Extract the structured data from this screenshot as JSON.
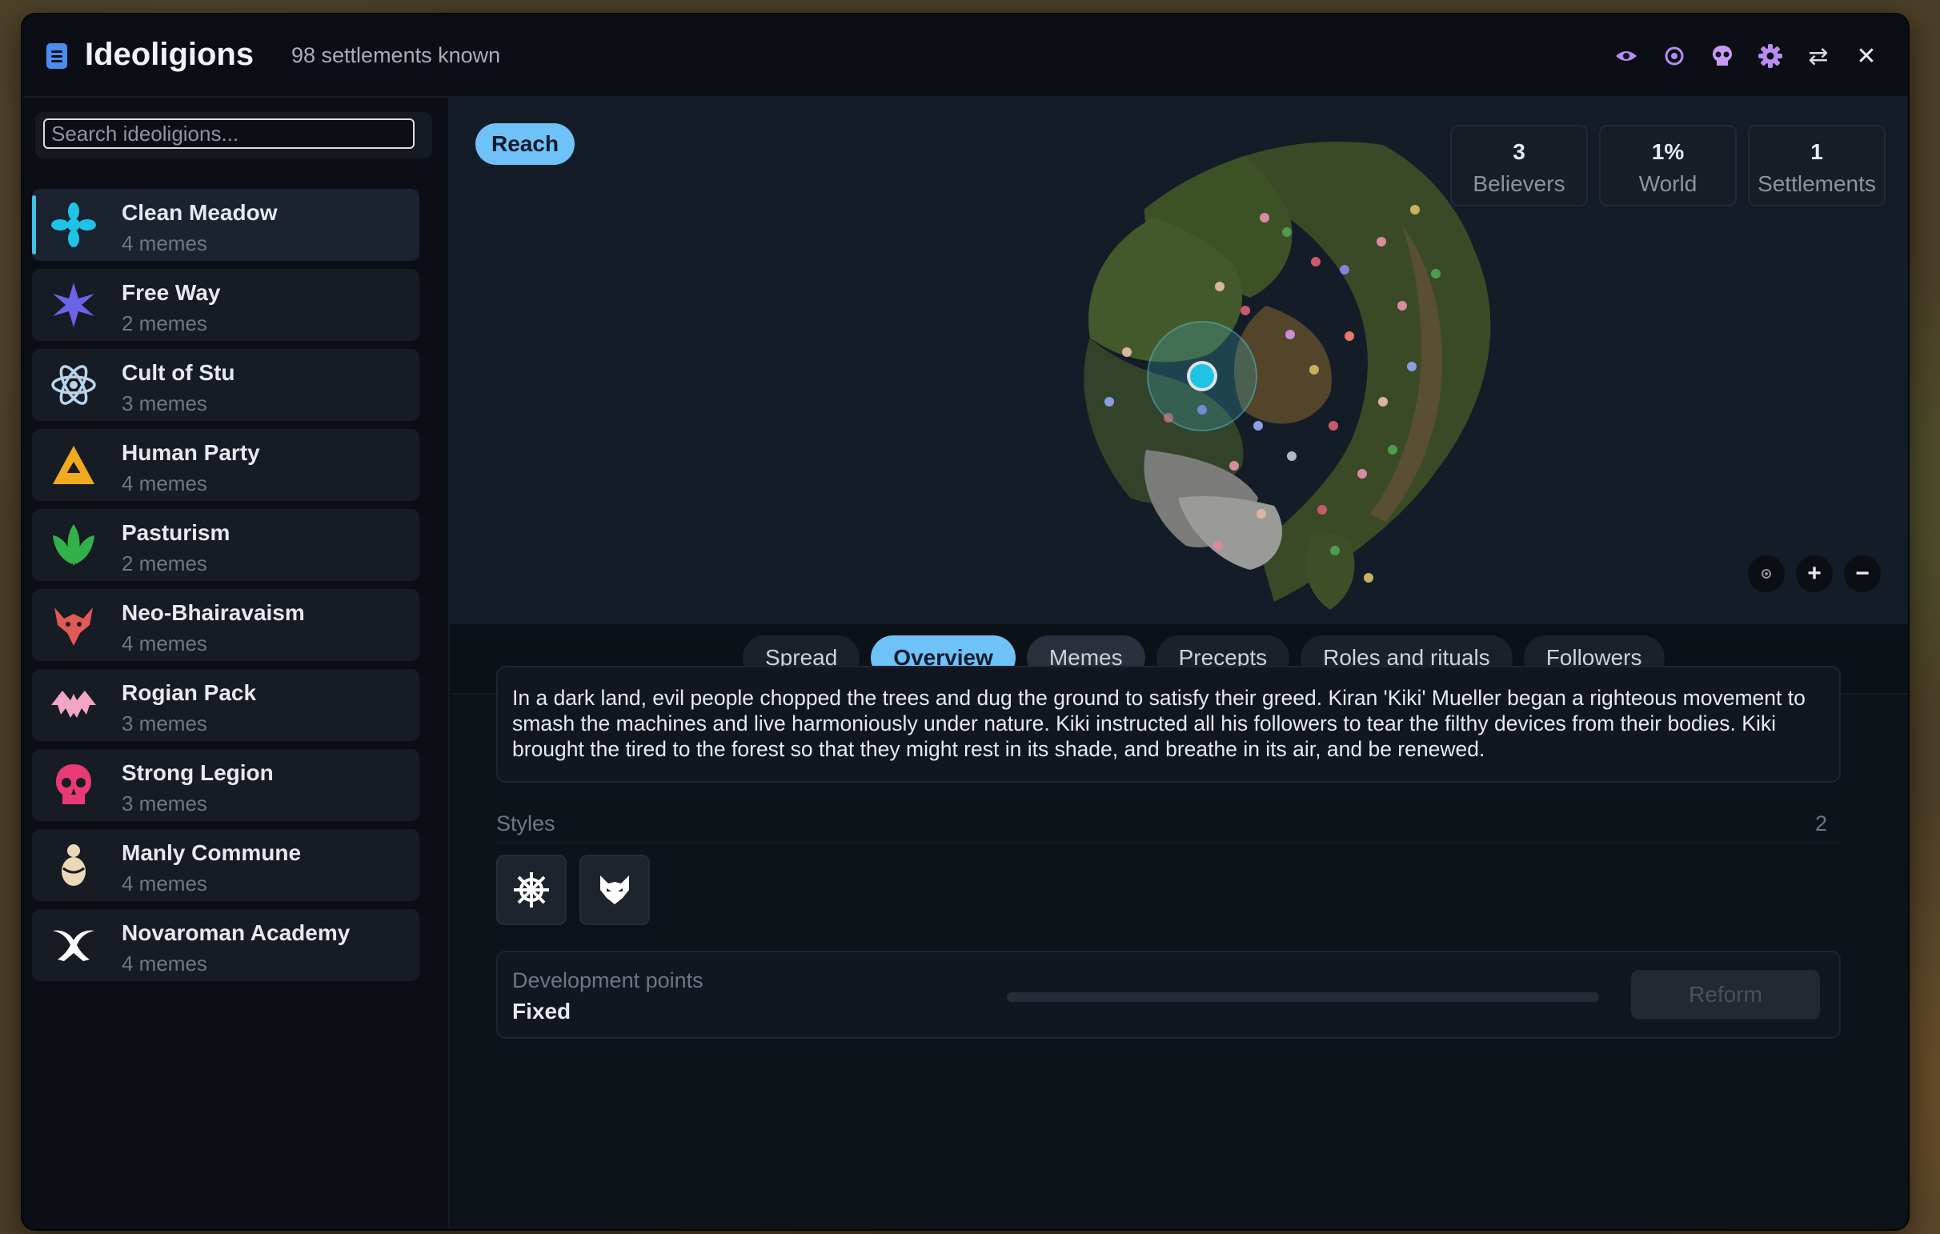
{
  "window": {
    "title": "Ideoligions",
    "subtitle": "98 settlements known",
    "toolbar_icons": [
      "eye-icon",
      "target-icon",
      "skull-icon",
      "gear-icon",
      "swap-icon",
      "close-icon"
    ],
    "close_glyph": "✕",
    "swap_glyph": "⇄"
  },
  "sidebar": {
    "search_placeholder": "Search ideoligions...",
    "items": [
      {
        "name": "Clean Meadow",
        "sub": "4 memes",
        "icon": "cross-flower-icon",
        "color": "#1fc3e6",
        "active": true
      },
      {
        "name": "Free Way",
        "sub": "2 memes",
        "icon": "star-burst-icon",
        "color": "#6b63e8"
      },
      {
        "name": "Cult of Stu",
        "sub": "3 memes",
        "icon": "atom-icon",
        "color": "#b9d4ec"
      },
      {
        "name": "Human Party",
        "sub": "4 memes",
        "icon": "triangle-icon",
        "color": "#f1a91e"
      },
      {
        "name": "Pasturism",
        "sub": "2 memes",
        "icon": "leaves-icon",
        "color": "#32b14a"
      },
      {
        "name": "Neo-Bhairavaism",
        "sub": "4 memes",
        "icon": "demon-icon",
        "color": "#e05a56"
      },
      {
        "name": "Rogian Pack",
        "sub": "3 memes",
        "icon": "bat-icon",
        "color": "#f2a6c4"
      },
      {
        "name": "Strong Legion",
        "sub": "3 memes",
        "icon": "skull-icon",
        "color": "#e83a74"
      },
      {
        "name": "Manly Commune",
        "sub": "4 memes",
        "icon": "figure-icon",
        "color": "#ead9b6"
      },
      {
        "name": "Novaroman Academy",
        "sub": "4 memes",
        "icon": "horns-icon",
        "color": "#ffffff"
      }
    ]
  },
  "map": {
    "reach_label": "Reach",
    "stats": [
      {
        "value": "3",
        "label": "Believers"
      },
      {
        "value": "1%",
        "label": "World"
      },
      {
        "value": "1",
        "label": "Settlements"
      }
    ],
    "controls": [
      "center-icon",
      "zoom-in-icon",
      "zoom-out-icon"
    ],
    "control_glyphs": [
      "",
      "+",
      "−"
    ]
  },
  "tabs": [
    {
      "label": "Spread"
    },
    {
      "label": "Overview",
      "active": true
    },
    {
      "label": "Memes",
      "hover": true
    },
    {
      "label": "Precepts"
    },
    {
      "label": "Roles and rituals"
    },
    {
      "label": "Followers"
    }
  ],
  "overview": {
    "description": "In a dark land, evil people chopped the trees and dug the ground to satisfy their greed. Kiran 'Kiki' Mueller began a righteous movement to smash the machines and live harmoniously under nature. Kiki instructed all his followers to tear the filthy devices from their bodies. Kiki brought the tired to the forest so that they might rest in its shade, and breathe in its air, and be renewed.",
    "styles_label": "Styles",
    "styles_count": "2",
    "styles": [
      "ship-wheel-icon",
      "wolf-head-icon"
    ],
    "dev_label": "Development points",
    "dev_value": "Fixed",
    "dev_progress": 0,
    "reform_label": "Reform"
  },
  "colors": {
    "accent": "#6fc2f7",
    "selected_marker": "#1fc3e6"
  }
}
